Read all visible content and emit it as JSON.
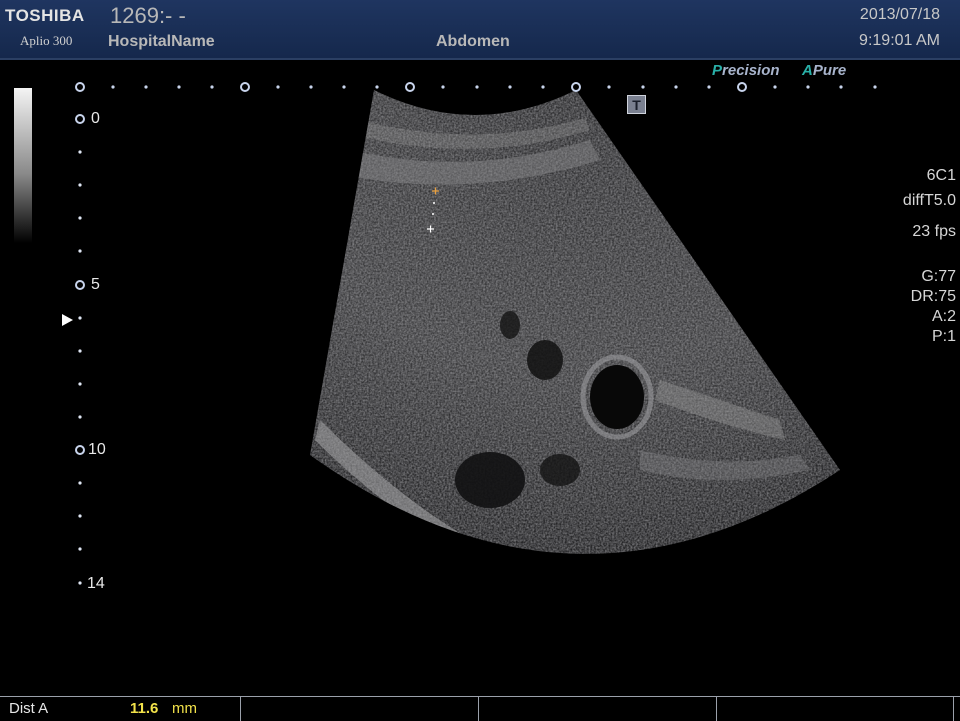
{
  "header": {
    "brand": "TOSHIBA",
    "model": "Aplio 300",
    "patient_id": "1269:- -",
    "hospital": "HospitalName",
    "exam": "Abdomen",
    "date": "2013/07/18",
    "time": "9:19:01 AM"
  },
  "modes": {
    "precision_lead": "P",
    "precision_rest": "recision",
    "apure_lead": "A",
    "apure_rest": "Pure"
  },
  "image": {
    "t_marker": "T",
    "depth_labels": [
      "0",
      "5",
      "10",
      "14"
    ]
  },
  "params": {
    "probe": "6C1",
    "preset": "diffT5.0",
    "fps": "23 fps",
    "gain": "G:77",
    "dr": "DR:75",
    "a": "A:2",
    "p": "P:1"
  },
  "measurement": {
    "name": "Dist  A",
    "value": "11.6",
    "unit": "mm"
  },
  "colors": {
    "header_bg": "#1f3560",
    "accent_teal": "#29b0a8",
    "measure_yellow": "#f2e24a"
  }
}
